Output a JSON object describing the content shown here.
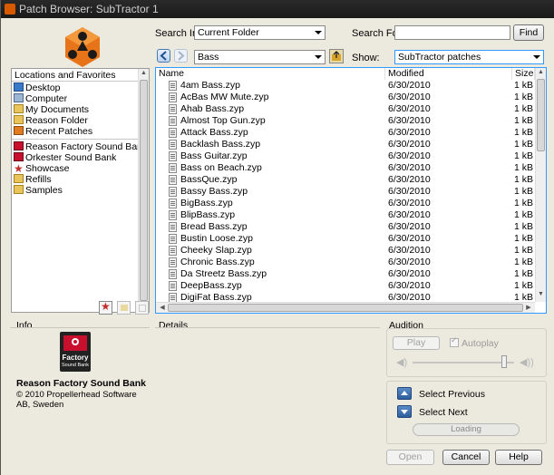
{
  "window": {
    "title": "Patch Browser: SubTractor 1"
  },
  "search_in": {
    "label": "Search In:",
    "value": "Current Folder"
  },
  "search_for": {
    "label": "Search For:",
    "value": "",
    "find_label": "Find"
  },
  "nav": {
    "folder": "Bass",
    "show_label": "Show:",
    "show_value": "SubTractor patches"
  },
  "locations": {
    "header": "Locations and Favorites",
    "items": [
      {
        "label": "Desktop",
        "icon": "desktop-icon"
      },
      {
        "label": "Computer",
        "icon": "computer-icon"
      },
      {
        "label": "My Documents",
        "icon": "folder-icon"
      },
      {
        "label": "Reason Folder",
        "icon": "folder-icon"
      },
      {
        "label": "Recent Patches",
        "icon": "recent-icon"
      },
      {
        "label": "Reason Factory Sound Bank",
        "icon": "soundbank-icon"
      },
      {
        "label": "Orkester Sound Bank",
        "icon": "soundbank-icon"
      },
      {
        "label": "Showcase",
        "icon": "star-icon"
      },
      {
        "label": "Refills",
        "icon": "folder-icon"
      },
      {
        "label": "Samples",
        "icon": "folder-icon"
      }
    ]
  },
  "files": {
    "columns": {
      "name": "Name",
      "modified": "Modified",
      "size": "Size"
    },
    "rows": [
      {
        "name": "4am Bass.zyp",
        "modified": "6/30/2010",
        "size": "1 kB"
      },
      {
        "name": "AcBas MW Mute.zyp",
        "modified": "6/30/2010",
        "size": "1 kB"
      },
      {
        "name": "Ahab Bass.zyp",
        "modified": "6/30/2010",
        "size": "1 kB"
      },
      {
        "name": "Almost Top Gun.zyp",
        "modified": "6/30/2010",
        "size": "1 kB"
      },
      {
        "name": "Attack Bass.zyp",
        "modified": "6/30/2010",
        "size": "1 kB"
      },
      {
        "name": "Backlash Bass.zyp",
        "modified": "6/30/2010",
        "size": "1 kB"
      },
      {
        "name": "Bass Guitar.zyp",
        "modified": "6/30/2010",
        "size": "1 kB"
      },
      {
        "name": "Bass on Beach.zyp",
        "modified": "6/30/2010",
        "size": "1 kB"
      },
      {
        "name": "BassQue.zyp",
        "modified": "6/30/2010",
        "size": "1 kB"
      },
      {
        "name": "Bassy Bass.zyp",
        "modified": "6/30/2010",
        "size": "1 kB"
      },
      {
        "name": "BigBass.zyp",
        "modified": "6/30/2010",
        "size": "1 kB"
      },
      {
        "name": "BlipBass.zyp",
        "modified": "6/30/2010",
        "size": "1 kB"
      },
      {
        "name": "Bread Bass.zyp",
        "modified": "6/30/2010",
        "size": "1 kB"
      },
      {
        "name": "Bustin Loose.zyp",
        "modified": "6/30/2010",
        "size": "1 kB"
      },
      {
        "name": "Cheeky Slap.zyp",
        "modified": "6/30/2010",
        "size": "1 kB"
      },
      {
        "name": "Chronic Bass.zyp",
        "modified": "6/30/2010",
        "size": "1 kB"
      },
      {
        "name": "Da Streetz Bass.zyp",
        "modified": "6/30/2010",
        "size": "1 kB"
      },
      {
        "name": "DeepBass.zyp",
        "modified": "6/30/2010",
        "size": "1 kB"
      },
      {
        "name": "DigiFat Bass.zyp",
        "modified": "6/30/2010",
        "size": "1 kB"
      }
    ]
  },
  "info": {
    "header": "Info",
    "badge_title": "Factory",
    "badge_sub": "Sound Bank",
    "bank_name": "Reason Factory Sound Bank",
    "copyright": "© 2010 Propellerhead Software AB, Sweden"
  },
  "details": {
    "header": "Details"
  },
  "audition": {
    "header": "Audition",
    "play_label": "Play",
    "autoplay_label": "Autoplay",
    "autoplay_checked": true,
    "volume": 0.9
  },
  "select": {
    "previous_label": "Select Previous",
    "next_label": "Select Next",
    "loading_label": "Loading"
  },
  "footer": {
    "open_label": "Open",
    "cancel_label": "Cancel",
    "help_label": "Help"
  },
  "colors": {
    "accent": "#3399ff",
    "logo_orange": "#e8741a",
    "badge_red": "#c8102e"
  }
}
